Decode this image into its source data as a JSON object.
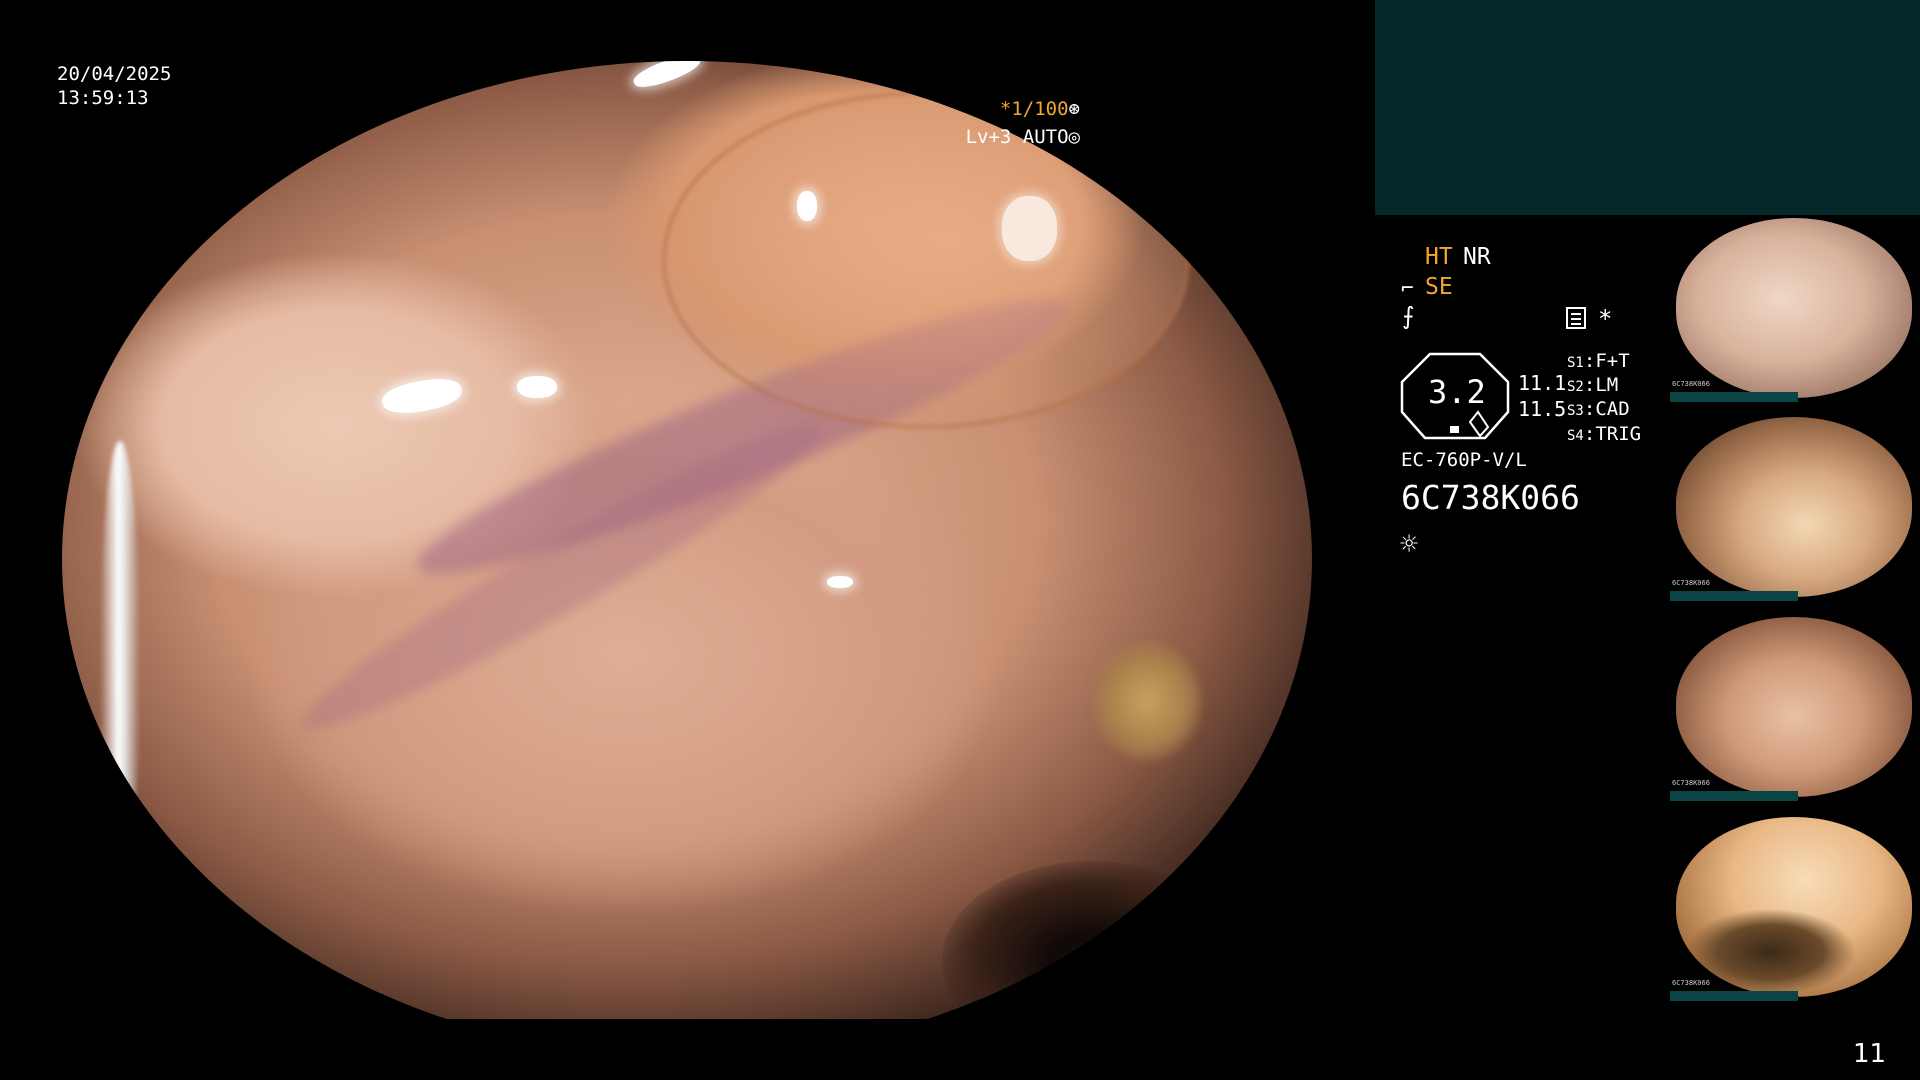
{
  "overlay": {
    "date": "20/04/2025",
    "time": "13:59:13",
    "shutter": "*1/100",
    "shutter_icon": "⊛",
    "level": "Lv+3 AUTO",
    "level_icon": "◎"
  },
  "status_panel": {
    "ht_label": "HT",
    "nr_label": "NR",
    "se_icon": "⌐",
    "se_label": "SE",
    "f_icon": "⨍",
    "asterisk": "*",
    "zoom_value": "3.2",
    "zoom_small_1": "11.1",
    "zoom_small_2": "11.5",
    "scope_buttons": [
      {
        "tag": "S1",
        "value": "F+T"
      },
      {
        "tag": "S2",
        "value": "LM"
      },
      {
        "tag": "S3",
        "value": "CAD"
      },
      {
        "tag": "S4",
        "value": "TRIG"
      }
    ],
    "scope_model": "EC-760P-V/L",
    "scope_serial": "6C738K066",
    "light_icon": "☼"
  },
  "thumbnails": {
    "caption": "6C738K066"
  },
  "frame_number": "11",
  "colors": {
    "accent_orange": "#f2a630",
    "panel_teal": "#052829",
    "text_white": "#ffffff"
  }
}
